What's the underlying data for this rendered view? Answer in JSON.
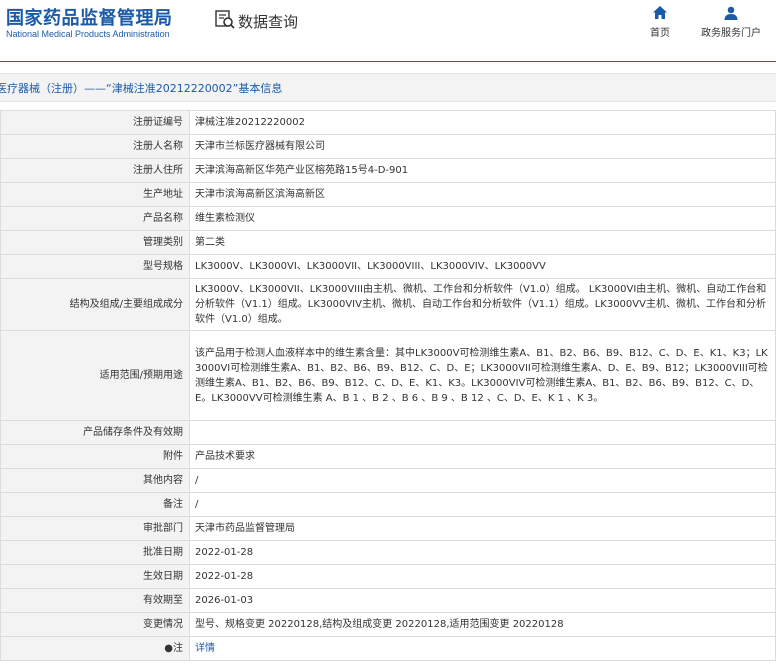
{
  "header": {
    "logo_cn": "国家药品监督管理局",
    "logo_en": "National Medical Products Administration",
    "search_label": "数据查询",
    "nav": [
      {
        "label": "首页",
        "icon": "home-icon"
      },
      {
        "label": "政务服务门户",
        "icon": "user-icon"
      }
    ]
  },
  "title": "医疗器械（注册）——“津械注准20212220002”基本信息",
  "rows": [
    {
      "label": "注册证编号",
      "value": "津械注准20212220002"
    },
    {
      "label": "注册人名称",
      "value": "天津市兰标医疗器械有限公司"
    },
    {
      "label": "注册人住所",
      "value": "天津滨海高新区华苑产业区榕苑路15号4-D-901"
    },
    {
      "label": "生产地址",
      "value": "天津市滨海高新区滨海高新区"
    },
    {
      "label": "产品名称",
      "value": "维生素检测仪"
    },
    {
      "label": "管理类别",
      "value": "第二类"
    },
    {
      "label": "型号规格",
      "value": "LK3000V、LK3000VI、LK3000VII、LK3000VIII、LK3000VIV、LK3000VV"
    },
    {
      "label": "结构及组成/主要组成成分",
      "value": "LK3000V、LK3000VII、LK3000VIII由主机、微机、工作台和分析软件（V1.0）组成。 LK3000VI由主机、微机、自动工作台和分析软件（V1.1）组成。LK3000VIV主机、微机、自动工作台和分析软件（V1.1）组成。LK3000VV主机、微机、工作台和分析软件（V1.0）组成。"
    },
    {
      "label": "适用范围/预期用途",
      "value": "该产品用于检测人血液样本中的维生素含量：其中LK3000V可检测维生素A、B1、B2、B6、B9、B12、C、D、E、K1、K3；LK3000VI可检测维生素A、B1、B2、B6、B9、B12、C、D、E；LK3000VII可检测维生素A、D、E、B9、B12；LK3000VIII可检测维生素A、B1、B2、B6、B9、B12、C、D、E、K1、K3。LK3000VIV可检测维生素A、B1、B2、B6、B9、B12、C、D、E。LK3000VV可检测维生素 A、B 1 、B 2 、B 6 、B 9 、B 12 、C、D、E、K 1 、K 3。"
    },
    {
      "label": "产品储存条件及有效期",
      "value": ""
    },
    {
      "label": "附件",
      "value": "产品技术要求"
    },
    {
      "label": "其他内容",
      "value": "/"
    },
    {
      "label": "备注",
      "value": "/"
    },
    {
      "label": "审批部门",
      "value": "天津市药品监督管理局"
    },
    {
      "label": "批准日期",
      "value": "2022-01-28"
    },
    {
      "label": "生效日期",
      "value": "2022-01-28"
    },
    {
      "label": "有效期至",
      "value": "2026-01-03"
    },
    {
      "label": "变更情况",
      "value": "型号、规格变更 20220128,结构及组成变更 20220128,适用范围变更 20220128"
    },
    {
      "label": "●注",
      "value": "详情",
      "link": true
    }
  ]
}
